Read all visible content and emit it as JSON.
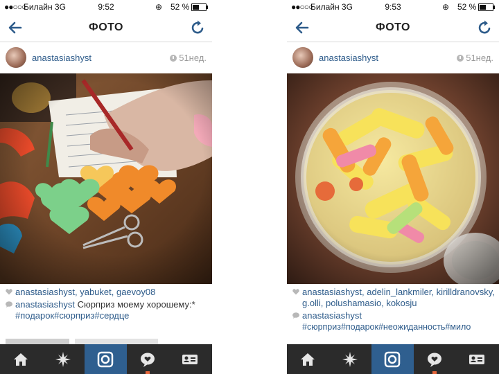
{
  "screens": [
    {
      "status": {
        "signal": "●●○○○",
        "carrier": "Билайн  3G",
        "time": "9:52",
        "battery": "52 %",
        "battery_level": 0.52
      },
      "nav": {
        "title": "ФОТО"
      },
      "post": {
        "username": "anastasiashyst",
        "time": "51нед.",
        "likes": "anastasiashyst, yabuket, gaevoy08",
        "comment_user": "anastasiashyst",
        "comment_text": " Сюрприз моему хорошему:*",
        "hashtags": "#подарок#сюрприз#сердце"
      }
    },
    {
      "status": {
        "signal": "●●○○○",
        "carrier": "Билайн  3G",
        "time": "9:53",
        "battery": "52 %",
        "battery_level": 0.52
      },
      "nav": {
        "title": "ФОТО"
      },
      "post": {
        "username": "anastasiashyst",
        "time": "51нед.",
        "likes": "anastasiashyst, adelin_lankmiler, kirilldranovsky, g.olli, polushamasio, kokosju",
        "comment_user": "anastasiashyst",
        "comment_text": "",
        "hashtags": "#сюрприз#подарок#неожиданность#мило"
      }
    }
  ],
  "tabs": [
    "home",
    "explore",
    "camera",
    "news",
    "profile"
  ],
  "icons": {
    "back": "back-arrow-icon",
    "refresh": "refresh-icon",
    "time": "clock-icon",
    "likes": "heart-icon",
    "comment": "comment-bubble-icon"
  },
  "colors": {
    "accent": "#2d5b8a",
    "tabbar": "#2b2b2b",
    "tab_active": "#2f5f8f",
    "notification": "#e8663b"
  }
}
